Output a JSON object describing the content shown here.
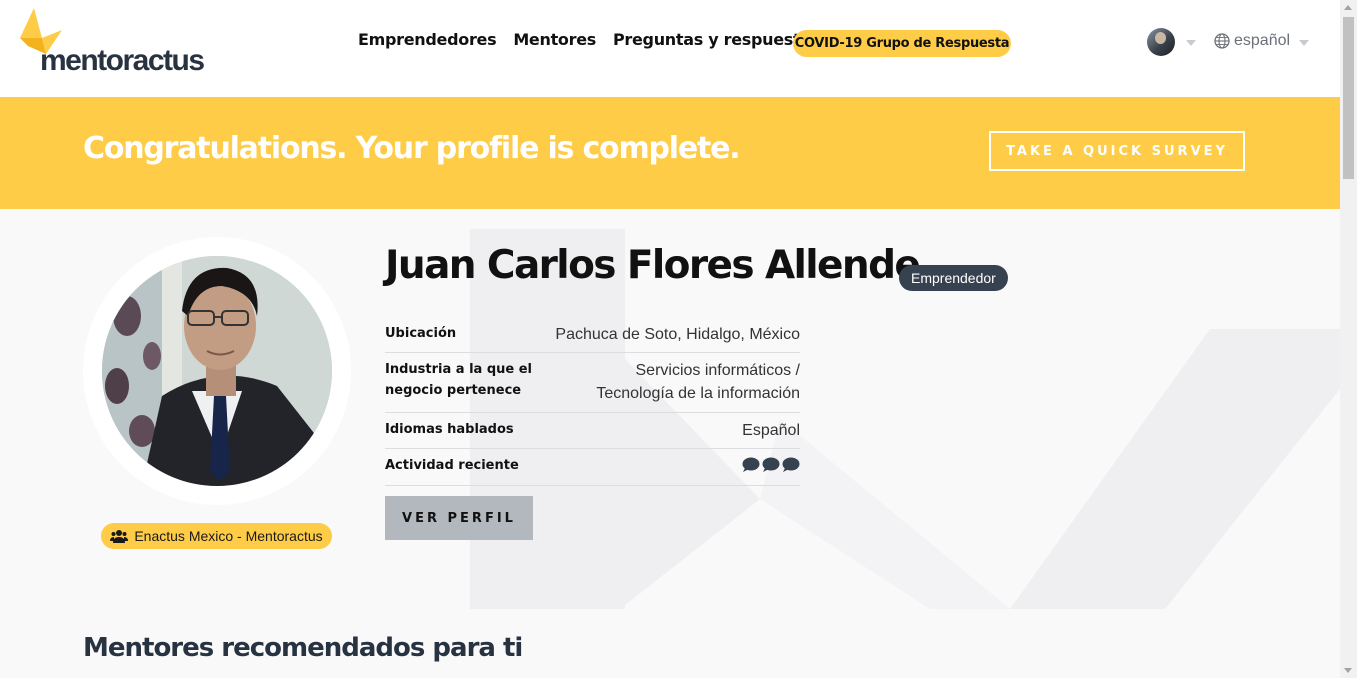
{
  "header": {
    "logo_text": "mentoractus",
    "nav": [
      {
        "label": "Emprendedores"
      },
      {
        "label": "Mentores"
      },
      {
        "label": "Preguntas y respuestas"
      }
    ],
    "covid_label": "COVID-19 Grupo de Respuesta",
    "language": "español",
    "icons": {
      "language": "globe-icon",
      "user_menu": "chevron-down-icon"
    }
  },
  "banner": {
    "message": "Congratulations. Your profile is complete.",
    "survey_label": "TAKE A QUICK SURVEY"
  },
  "profile": {
    "name": "Juan Carlos Flores Allende",
    "role": "Emprendedor",
    "organization": "Enactus Mexico - Mentoractus",
    "details": [
      {
        "label": "Ubicación",
        "value": "Pachuca de Soto, Hidalgo, México"
      },
      {
        "label_line1": "Industria a la que el",
        "label_line2": "negocio pertenece",
        "value_line1": "Servicios informáticos /",
        "value_line2": "Tecnología de la información"
      },
      {
        "label": "Idiomas hablados",
        "value": "Español"
      },
      {
        "label": "Actividad reciente",
        "activity_icon": "speech-bubble-icon",
        "activity_count": 3
      }
    ],
    "view_profile_label": "VER PERFIL"
  },
  "recommended": {
    "title": "Mentores recomendados para ti"
  },
  "colors": {
    "accent": "#fecc47",
    "dark": "#374250",
    "heading": "#283342",
    "background": "#f9f9fa"
  }
}
